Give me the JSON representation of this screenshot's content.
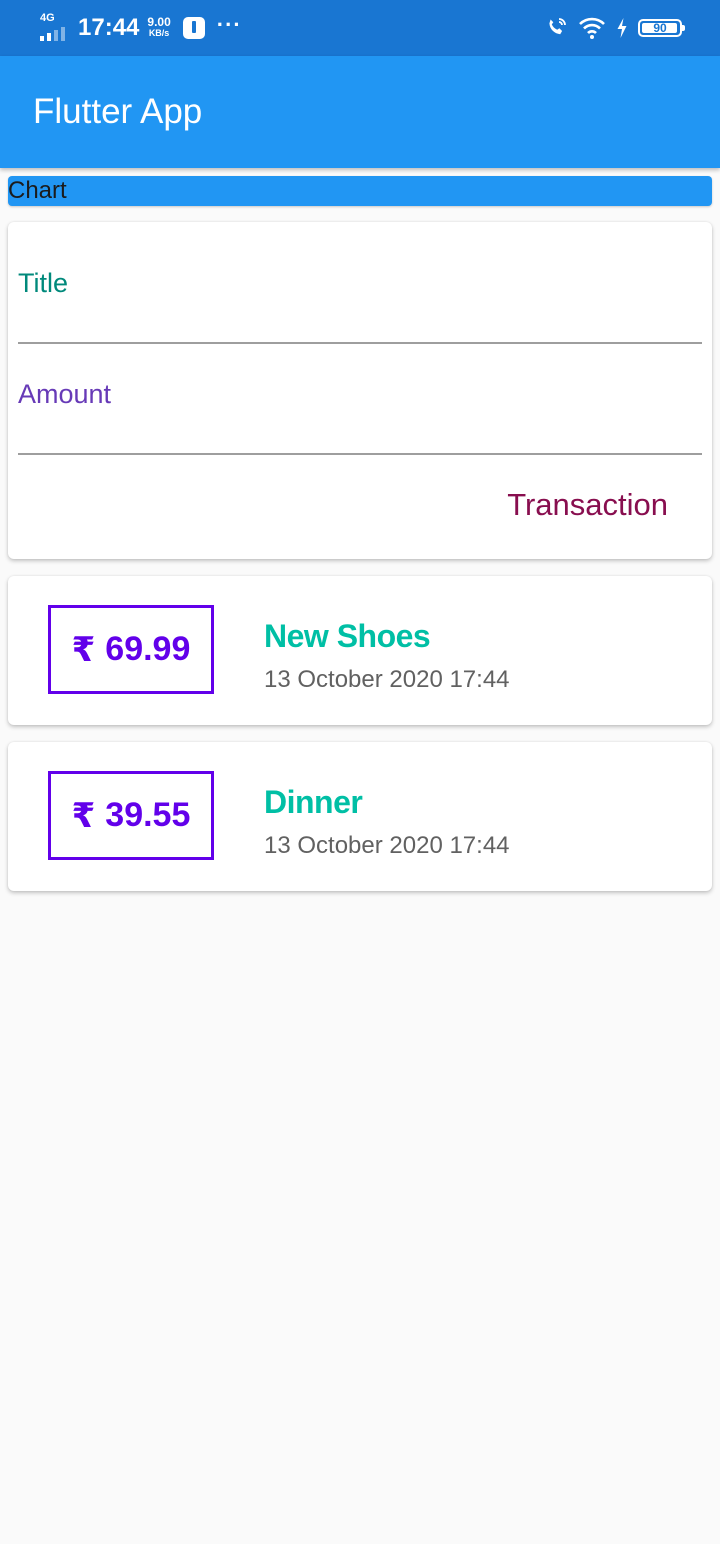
{
  "status_bar": {
    "network": "4G",
    "time": "17:44",
    "speed_value": "9.00",
    "speed_unit": "KB/s",
    "more": "···",
    "battery": "90",
    "icons": [
      "signal-icon",
      "usb-icon",
      "more-icon",
      "wifi-calling-icon",
      "wifi-icon",
      "charging-icon",
      "battery-icon"
    ]
  },
  "app_bar": {
    "title": "Flutter App"
  },
  "chart": {
    "label": "Chart"
  },
  "form": {
    "title_label": "Title",
    "title_value": "",
    "amount_label": "Amount",
    "amount_value": "",
    "submit_label": "Transaction"
  },
  "transactions": [
    {
      "currency": "₹",
      "amount": "69.99",
      "title": "New Shoes",
      "date": "13 October 2020 17:44"
    },
    {
      "currency": "₹",
      "amount": "39.55",
      "title": "Dinner",
      "date": "13 October 2020 17:44"
    }
  ],
  "colors": {
    "status_bar": "#1976d2",
    "app_bar": "#2196f3",
    "title_label": "#00897b",
    "amount_label": "#673ab7",
    "button_text": "#880e4f",
    "amount_accent": "#6200ea",
    "transaction_title": "#00bfa5",
    "date_text": "#616161",
    "background": "#fafafa"
  }
}
